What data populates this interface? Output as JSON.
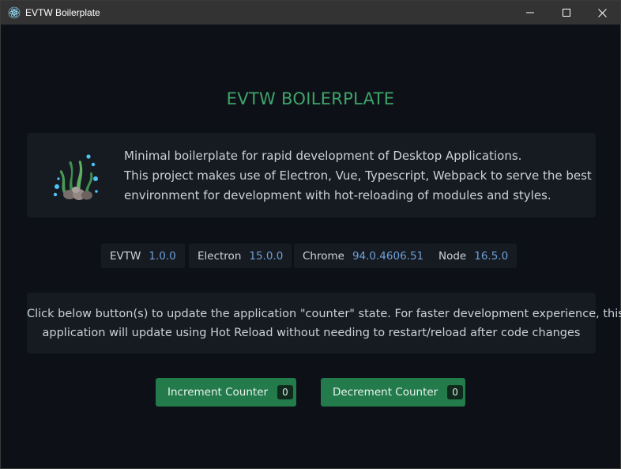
{
  "window": {
    "title": "EVTW Boilerplate",
    "controls": [
      "minimize-icon",
      "maximize-icon",
      "close-icon"
    ]
  },
  "main": {
    "heading": "EVTW BOILERPLATE",
    "intro": {
      "icon": "seaweed-rocks-bubbles-icon",
      "lines": [
        "Minimal boilerplate for rapid development of Desktop Applications.",
        "This project makes use of Electron, Vue, Typescript, Webpack to serve the best",
        "environment for development with hot-reloading of modules and styles."
      ]
    },
    "versions": [
      {
        "name": "EVTW",
        "value": "1.0.0"
      },
      {
        "name": "Electron",
        "value": "15.0.0"
      },
      {
        "name": "Chrome",
        "value": "94.0.4606.51"
      },
      {
        "name": "Node",
        "value": "16.5.0"
      }
    ],
    "note": {
      "lines": [
        "Click below button(s) to update the application \"counter\" state. For faster development experience, this",
        "application will update using Hot Reload without needing to restart/reload after code changes"
      ]
    },
    "buttons": [
      {
        "label": "Increment Counter",
        "count": "0"
      },
      {
        "label": "Decrement Counter",
        "count": "0"
      }
    ]
  },
  "colors": {
    "accent": "#3fa46a",
    "button_bg": "#237a4b",
    "card_bg": "#161b22",
    "page_bg": "#0d1117",
    "version_value": "#6f9fd8"
  }
}
